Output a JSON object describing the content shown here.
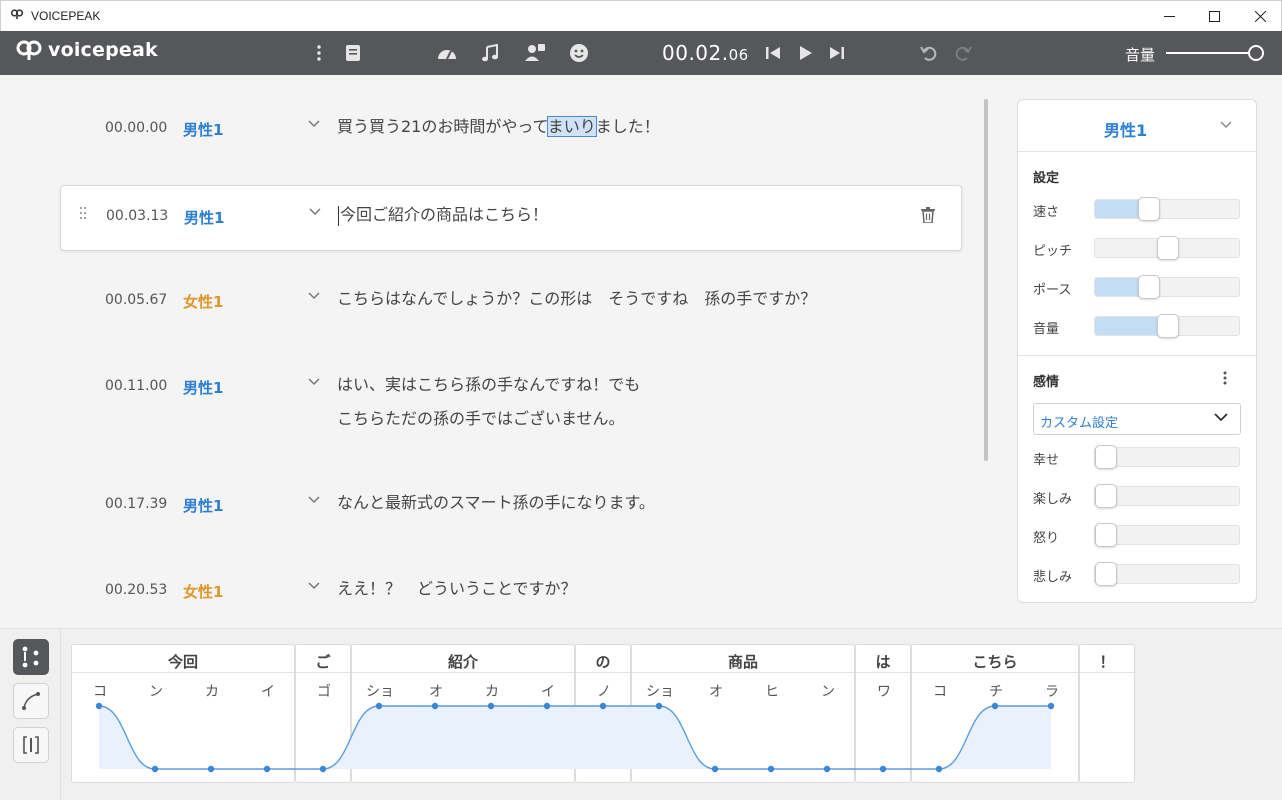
{
  "window": {
    "title": "VOICEPEAK"
  },
  "toolbar": {
    "brand": "voicepeak",
    "time_main": "00.02.",
    "time_sub": "06",
    "volume_label": "音量",
    "volume_level": 1.0
  },
  "rows": [
    {
      "time": "00.00.00",
      "speaker": "男性1",
      "text_before": "買う買う21のお時間がやって",
      "text_highlight": "まいり",
      "text_after": "ました！"
    },
    {
      "time": "00.03.13",
      "speaker": "男性1",
      "text": "今回ご紹介の商品はこちら！"
    },
    {
      "time": "00.05.67",
      "speaker": "女性1",
      "text": "こちらはなんでしょうか？この形は　そうですね　孫の手ですか？"
    },
    {
      "time": "00.11.00",
      "speaker": "男性1",
      "text_line1": "はい、実はこちら孫の手なんですね！でも",
      "text_line2": "こちらただの孫の手ではございません。"
    },
    {
      "time": "00.17.39",
      "speaker": "男性1",
      "text": "なんと最新式のスマート孫の手になります。"
    },
    {
      "time": "00.20.53",
      "speaker": "女性1",
      "text": "ええ！？　どういうことですか？"
    }
  ],
  "panel": {
    "voice": "男性1",
    "settings_title": "設定",
    "settings": [
      {
        "label": "速さ",
        "value": 0.35
      },
      {
        "label": "ピッチ",
        "value": 0.5
      },
      {
        "label": "ポース",
        "value": 0.35
      },
      {
        "label": "音量",
        "value": 0.5
      }
    ],
    "emotion_title": "感情",
    "emotion_preset": "カスタム設定",
    "emotions": [
      {
        "label": "幸せ",
        "value": 0
      },
      {
        "label": "楽しみ",
        "value": 0
      },
      {
        "label": "怒り",
        "value": 0
      },
      {
        "label": "悲しみ",
        "value": 0
      }
    ]
  },
  "phoneme": {
    "words": [
      {
        "word": "今回",
        "morae": [
          "コ",
          "ン",
          "カ",
          "イ"
        ]
      },
      {
        "word": "ご",
        "morae": [
          "ゴ"
        ]
      },
      {
        "word": "紹介",
        "morae": [
          "ショ",
          "オ",
          "カ",
          "イ"
        ]
      },
      {
        "word": "の",
        "morae": [
          "ノ"
        ]
      },
      {
        "word": "商品",
        "morae": [
          "ショ",
          "オ",
          "ヒ",
          "ン"
        ]
      },
      {
        "word": "は",
        "morae": [
          "ワ"
        ]
      },
      {
        "word": "こちら",
        "morae": [
          "コ",
          "チ",
          "ラ"
        ]
      },
      {
        "word": "！",
        "morae": []
      }
    ],
    "accent": [
      1,
      0,
      0,
      0,
      0,
      1,
      1,
      1,
      1,
      1,
      1,
      0,
      0,
      0,
      0,
      0,
      1,
      1
    ]
  }
}
